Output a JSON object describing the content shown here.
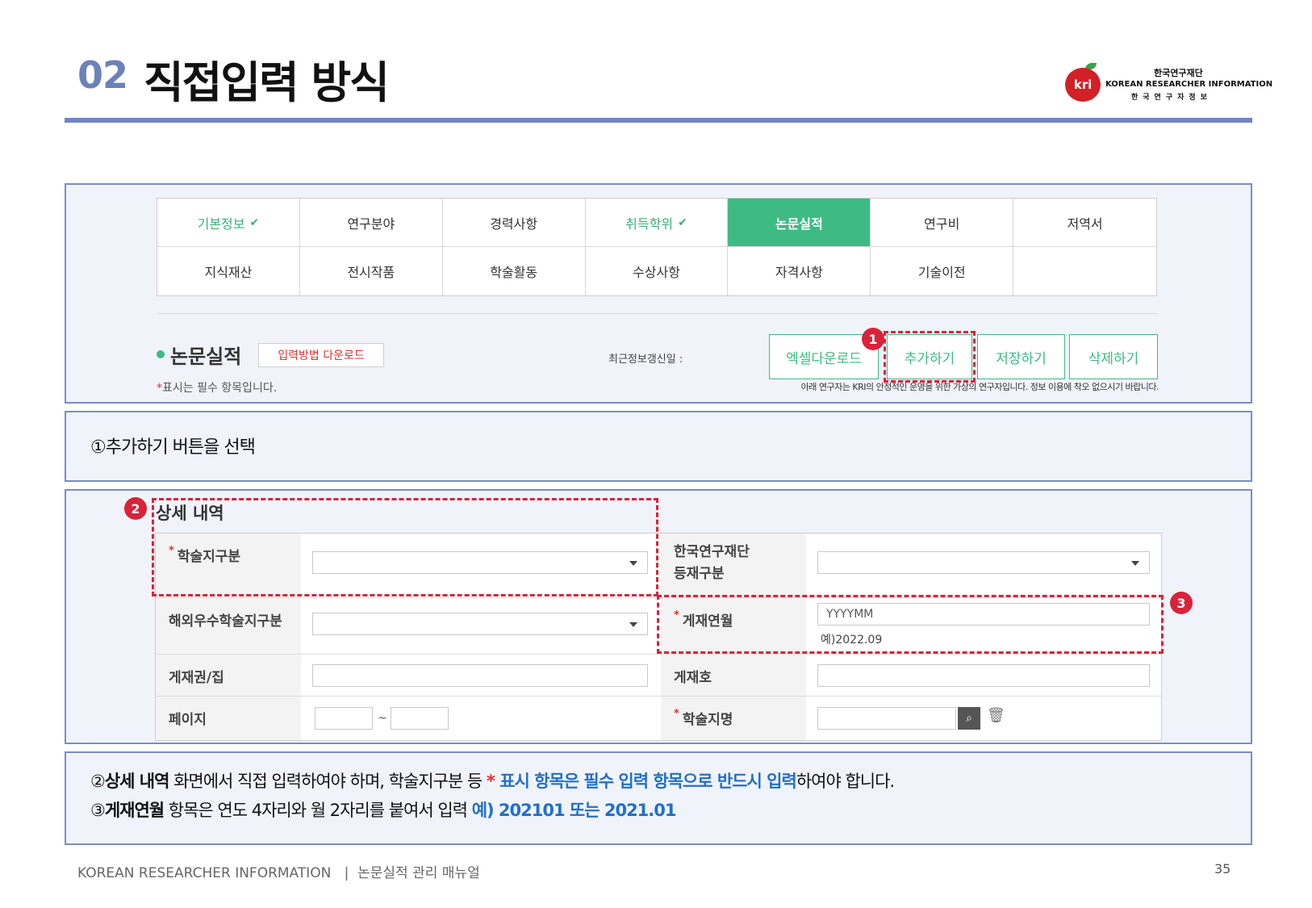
{
  "header": {
    "section_number": "02",
    "title": "직접입력 방식",
    "logo": {
      "mark": "kri",
      "org_kr": "한국연구재단",
      "org_en": "KOREAN RESEARCHER INFORMATION",
      "org_spaced": "한국연구자정보"
    }
  },
  "top_panel": {
    "tabs": [
      {
        "label": "기본정보",
        "state": "done"
      },
      {
        "label": "연구분야",
        "state": "normal"
      },
      {
        "label": "경력사항",
        "state": "normal"
      },
      {
        "label": "취득학위",
        "state": "done"
      },
      {
        "label": "논문실적",
        "state": "active"
      },
      {
        "label": "연구비",
        "state": "normal"
      },
      {
        "label": "저역서",
        "state": "normal"
      },
      {
        "label": "지식재산",
        "state": "normal"
      },
      {
        "label": "전시작품",
        "state": "normal"
      },
      {
        "label": "학술활동",
        "state": "normal"
      },
      {
        "label": "수상사항",
        "state": "normal"
      },
      {
        "label": "자격사항",
        "state": "normal"
      },
      {
        "label": "기술이전",
        "state": "normal"
      },
      {
        "label": "",
        "state": "empty"
      }
    ],
    "section_title": "논문실적",
    "download_method_label": "입력방법 다운로드",
    "required_note_star": "*",
    "required_note": "표시는 필수 항목입니다.",
    "last_update_label": "최근정보갱신일 :",
    "buttons": {
      "excel": "엑셀다운로드",
      "add": "추가하기",
      "save": "저장하기",
      "delete": "삭제하기"
    },
    "virtual_note": "아래 연구자는 KRI의 안정적인 운영을 위한 가상의 연구자입니다. 정보 이용에 착오 없으시기 바랍니다.",
    "badge_1": "1"
  },
  "step1_text": "①추가하기 버튼을 선택",
  "detail": {
    "title": "상세 내역",
    "badge_2": "2",
    "badge_3": "3",
    "fields": {
      "academic_type": {
        "label": "학술지구분",
        "required": "*"
      },
      "nrf_type": {
        "label_line1": "한국연구재단",
        "label_line2": "등재구분"
      },
      "overseas_type": {
        "label": "해외우수학술지구분"
      },
      "pub_date": {
        "label": "게재연월",
        "required": "*",
        "placeholder": "YYYYMM",
        "example": "예)2022.09"
      },
      "volume": {
        "label": "게재권/집"
      },
      "issue": {
        "label": "게재호"
      },
      "page": {
        "label": "페이지",
        "separator": "~"
      },
      "journal": {
        "label": "학술지명",
        "required": "*"
      }
    }
  },
  "instructions": {
    "line2_prefix": "②",
    "line2_bold": "상세 내역",
    "line2_text": " 화면에서 직접 입력하여야 하며, 학술지구분 등 ",
    "line2_star": "*",
    "line2_highlight": " 표시 항목은 필수 입력 항목으로 반드시 입력",
    "line2_end": "하여야 합니다.",
    "line3_prefix": "③",
    "line3_bold": "게재연월",
    "line3_text": " 항목은 연도 4자리와 월 2자리를 붙여서 입력 ",
    "line3_highlight": "예) 202101 또는 2021.01"
  },
  "footer": {
    "org": "KOREAN RESEARCHER INFORMATION",
    "separator": "|",
    "manual": "논문실적 관리 매뉴얼",
    "page_number": "35"
  },
  "colors": {
    "accent_blue": "#7285bf",
    "green": "#3dbb83",
    "red": "#d8233a",
    "highlight_blue": "#2170c9"
  }
}
